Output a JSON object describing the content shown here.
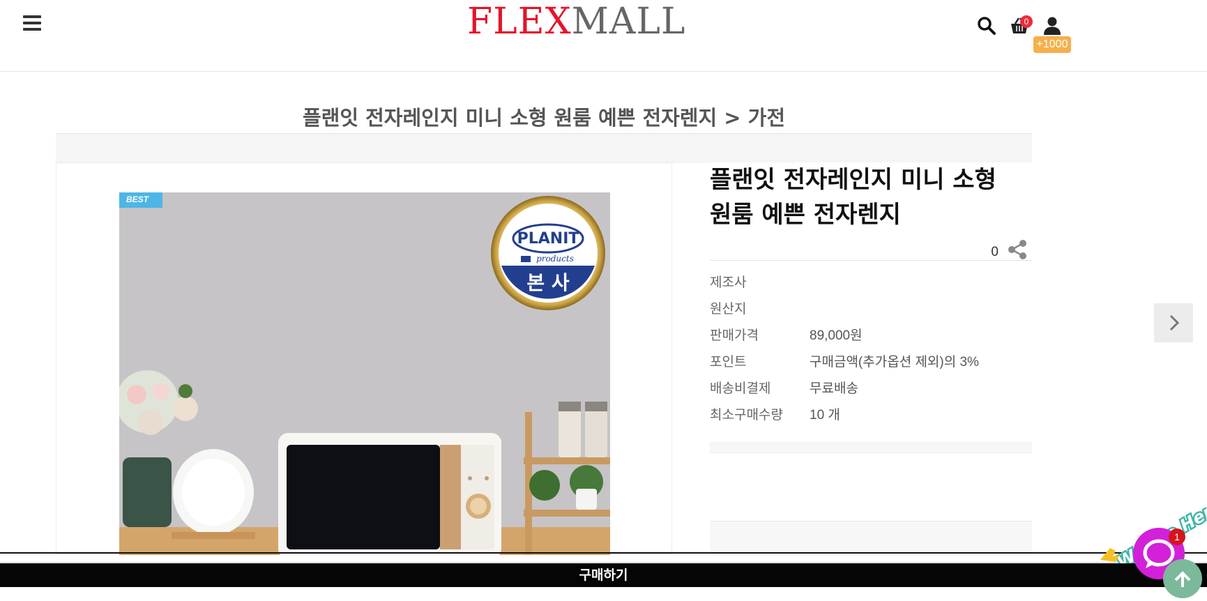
{
  "header": {
    "logo_part1": "FLEX",
    "logo_part2": "MALL",
    "cart_count": "0",
    "points_badge": "+1000"
  },
  "breadcrumb": "플랜잇 전자레인지 미니 소형 원룸 예쁜 전자렌지 > 가전",
  "product": {
    "badge": "BEST",
    "brand_emblem": "PLANIT",
    "emblem_sub": "products",
    "emblem_bottom": "본 사",
    "name": "플랜잇 전자레인지 미니 소형 원룸 예쁜 전자렌지",
    "like_count": "0",
    "specs": [
      {
        "label": "제조사",
        "value": ""
      },
      {
        "label": "원산지",
        "value": ""
      },
      {
        "label": "판매가격",
        "value": "89,000원"
      },
      {
        "label": "포인트",
        "value": "구매금액(추가옵션 제외)의 3%"
      },
      {
        "label": "배송비결제",
        "value": "무료배송"
      },
      {
        "label": "최소구매수량",
        "value": "10 개"
      }
    ]
  },
  "buy_button_label": "구매하기",
  "chat": {
    "banner_text": "We Are Here!",
    "unread": "1"
  },
  "colors": {
    "brand_red": "#e4142b",
    "badge_blue": "#4db6e6",
    "points_orange": "#f5b04c",
    "chat_purple": "#d221d8"
  }
}
